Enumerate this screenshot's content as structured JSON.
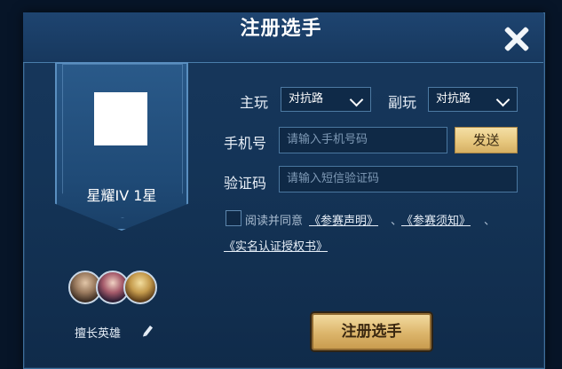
{
  "dialog": {
    "title": "注册选手"
  },
  "profile": {
    "rank": "星耀IV 1星",
    "heroes": [
      {
        "icon": "hero-portrait-1"
      },
      {
        "icon": "hero-portrait-2"
      },
      {
        "icon": "hero-portrait-3"
      }
    ],
    "heroes_label": "擅长英雄"
  },
  "form": {
    "main_role_label": "主玩",
    "main_role_value": "对抗路",
    "sub_role_label": "副玩",
    "sub_role_value": "对抗路",
    "phone_label": "手机号",
    "phone_placeholder": "请输入手机号码",
    "send_label": "发送",
    "code_label": "验证码",
    "code_placeholder": "请输入短信验证码",
    "agree_text": "阅读并同意",
    "link1": "《参赛声明》",
    "sep1": "、",
    "link2": "《参赛须知》",
    "sep2": "、",
    "link3": "《实名认证授权书》"
  },
  "register_label": "注册选手",
  "colors": {
    "accent_gold": "#e7c87f",
    "panel_blue": "#143457"
  }
}
